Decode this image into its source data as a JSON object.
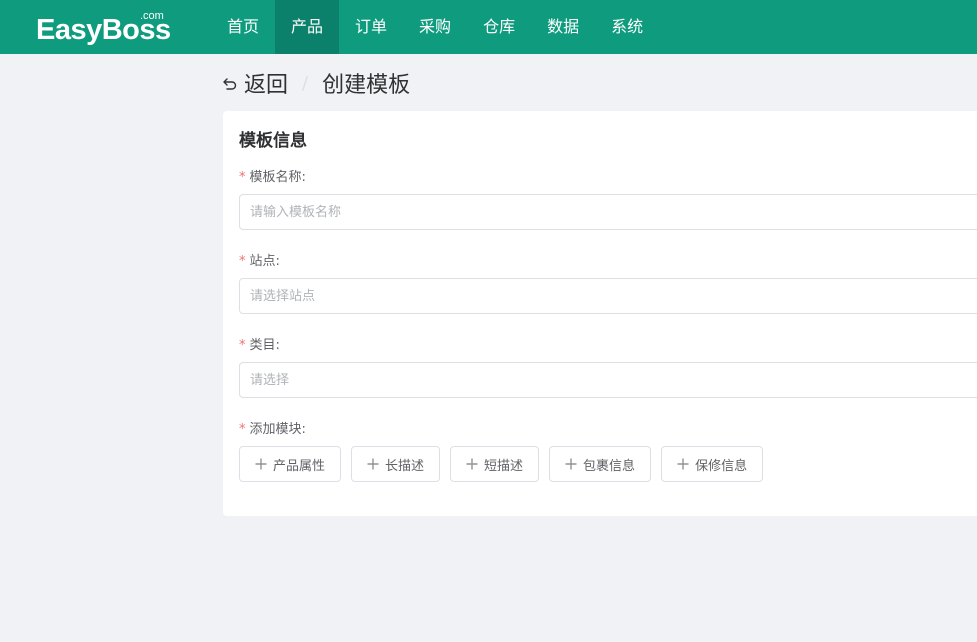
{
  "brand": {
    "logo_text": "EasyBoss",
    "logo_suffix": ".com"
  },
  "nav": {
    "items": [
      {
        "label": "首页"
      },
      {
        "label": "产品",
        "active": true
      },
      {
        "label": "订单"
      },
      {
        "label": "采购"
      },
      {
        "label": "仓库"
      },
      {
        "label": "数据"
      },
      {
        "label": "系统"
      }
    ]
  },
  "breadcrumb": {
    "back_label": "返回",
    "separator": "/",
    "title": "创建模板"
  },
  "form": {
    "section_title": "模板信息",
    "required_mark": "*",
    "template_name": {
      "label": "模板名称:",
      "placeholder": "请输入模板名称"
    },
    "site": {
      "label": "站点:",
      "placeholder": "请选择站点"
    },
    "category": {
      "label": "类目:",
      "placeholder": "请选择"
    },
    "modules": {
      "label": "添加模块:",
      "buttons": [
        {
          "label": "产品属性"
        },
        {
          "label": "长描述"
        },
        {
          "label": "短描述"
        },
        {
          "label": "包裹信息"
        },
        {
          "label": "保修信息"
        }
      ]
    }
  },
  "colors": {
    "header_bg": "#0f9b7e",
    "active_nav_bg": "#0b806a",
    "required": "#f56c6c",
    "page_bg": "#f0f2f5"
  },
  "icons": {
    "back": "undo-arrow-icon",
    "add": "plus-icon"
  }
}
